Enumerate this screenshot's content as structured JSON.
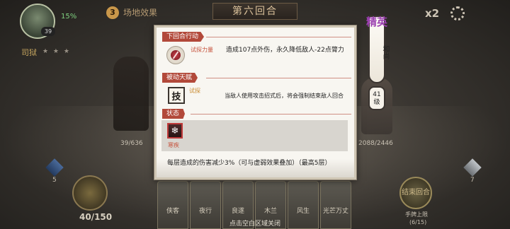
{
  "hud": {
    "portrait_level": "39",
    "hp_percent": "15%",
    "round_badge": "3",
    "field_effect": "场地效果",
    "round_title": "第六回合",
    "speed": "x2",
    "side_label": "司狱",
    "stars": "★ ★ ★",
    "left_hero_hp": "39/636",
    "right_hero_hp": "2088/2446",
    "left_gem_count": "5",
    "energy": "40/150",
    "right_gem_count": "7",
    "end_turn_label": "结束回合",
    "hand_limit_label": "手牌上限",
    "hand_count": "(6/15)",
    "cards": [
      "侠客",
      "夜行",
      "良遂",
      "木兰",
      "风生",
      "光芒万丈"
    ],
    "close_hint": "点击空白区域关闭"
  },
  "enemy_tag": {
    "rank": "精英",
    "name": "和尚",
    "level": "41级"
  },
  "panel": {
    "next_action_header": "下回合行动",
    "next_action_name": "试探力量",
    "next_action_desc": "造成107点外伤，永久降低敌人-22点膂力",
    "passive_header": "被动天赋",
    "passive_icon_glyph": "技",
    "passive_name": "试探",
    "passive_desc": "当敌人使用攻击招式后，将会强制结束敌人回合",
    "status_header": "状态",
    "status_icon_glyph": "❄",
    "status_name": "寒疾",
    "status_desc": "每层造成的伤害减少3%（可与虚弱效果叠加）（最高5层）"
  },
  "colors": {
    "header_red": "#b2493a",
    "elite_purple": "#9b3fb0",
    "status_red": "#bf3a3a"
  }
}
